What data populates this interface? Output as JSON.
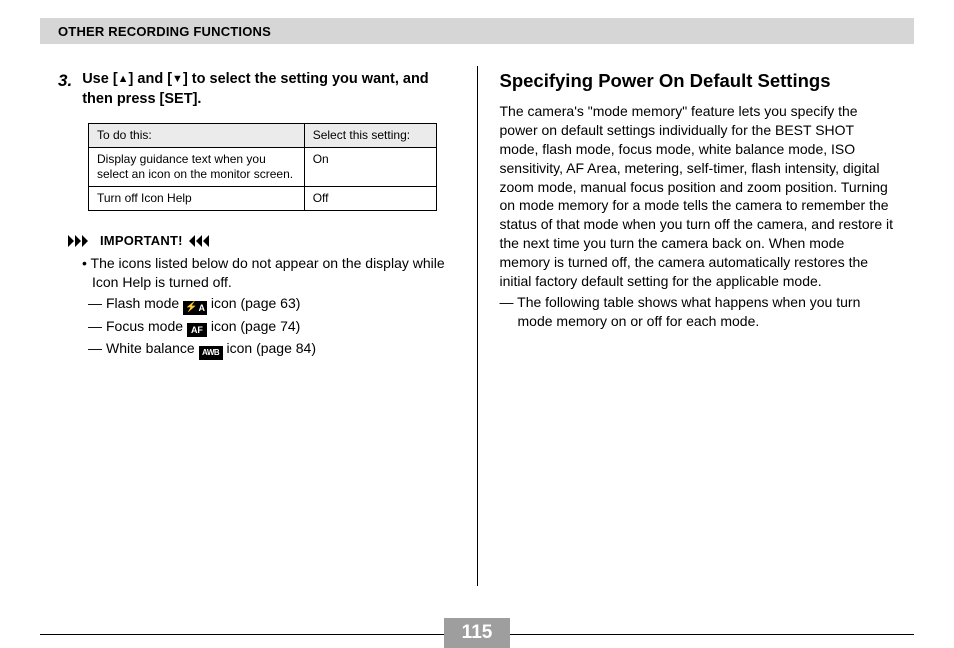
{
  "header": {
    "title": "OTHER RECORDING FUNCTIONS"
  },
  "left": {
    "step_number": "3.",
    "step_text_a": "Use [",
    "step_text_b": "] and [",
    "step_text_c": "] to select the setting you want, and then press [SET].",
    "table": {
      "th1": "To do this:",
      "th2": "Select this setting:",
      "r1c1": "Display guidance text when you select an icon on the monitor screen.",
      "r1c2": "On",
      "r2c1": "Turn off Icon Help",
      "r2c2": "Off"
    },
    "important_label": "IMPORTANT!",
    "bullet_intro": "The icons listed below do not appear on the display while Icon Help is turned off.",
    "sub1a": "Flash mode ",
    "sub1_badge": "A",
    "sub1b": " icon (page 63)",
    "sub2a": "Focus mode ",
    "sub2_badge": "AF",
    "sub2b": " icon (page 74)",
    "sub3a": "White balance ",
    "sub3_badge": "AWB",
    "sub3b": " icon (page 84)"
  },
  "right": {
    "heading": "Specifying Power On Default Settings",
    "body": "The camera's \"mode memory\" feature lets you specify the power on default settings individually for the BEST SHOT mode, flash mode, focus mode, white balance mode, ISO sensitivity, AF Area, metering, self-timer, flash intensity, digital zoom mode, manual focus position and zoom position. Turning on mode memory for a mode tells the camera to remember the status of that mode when you turn off the camera, and restore it the next time you turn the camera back on. When mode memory is turned off, the camera automatically restores the initial factory default setting for the applicable mode.",
    "sub": "— The following table shows what happens when you turn mode memory on or off for each mode."
  },
  "page_number": "115"
}
